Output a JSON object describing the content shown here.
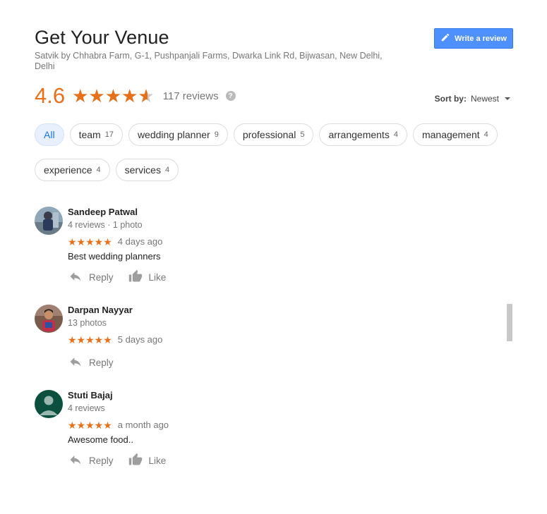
{
  "place": {
    "title": "Get Your Venue",
    "address": "Satvik by Chhabra Farm, G-1, Pushpanjali Farms, Dwarka Link Rd, Bijwasan, New Delhi, Delhi"
  },
  "write_review_label": "Write a review",
  "rating": {
    "value": "4.6",
    "stars_fraction": 0.92,
    "count_label": "117 reviews",
    "help_icon": "?"
  },
  "sort": {
    "label": "Sort by:",
    "value": "Newest"
  },
  "chips": [
    {
      "label": "All",
      "count": "",
      "active": true
    },
    {
      "label": "team",
      "count": "17"
    },
    {
      "label": "wedding planner",
      "count": "9"
    },
    {
      "label": "professional",
      "count": "5"
    },
    {
      "label": "arrangements",
      "count": "4"
    },
    {
      "label": "management",
      "count": "4"
    },
    {
      "label": "experience",
      "count": "4"
    },
    {
      "label": "services",
      "count": "4"
    }
  ],
  "reviews": [
    {
      "name": "Sandeep Patwal",
      "meta": "4 reviews · 1 photo",
      "stars": "★★★★★",
      "date": "4 days ago",
      "text": "Best wedding planners",
      "reply_label": "Reply",
      "like_label": "Like"
    },
    {
      "name": "Darpan Nayyar",
      "meta": "13 photos",
      "stars": "★★★★★",
      "date": "5 days ago",
      "text": "",
      "reply_label": "Reply"
    },
    {
      "name": "Stuti Bajaj",
      "meta": "4 reviews",
      "stars": "★★★★★",
      "date": "a month ago",
      "text": "Awesome food..",
      "reply_label": "Reply",
      "like_label": "Like"
    }
  ],
  "colors": {
    "accent_orange": "#e7711b",
    "button_blue": "#4d90fe",
    "chip_active_bg": "#e8f0fe",
    "avatar_default": "#0b4f3f"
  },
  "icons": {
    "write": "pencil-icon",
    "reply": "reply-icon",
    "like": "thumbs-up-icon",
    "sort": "caret-down-icon",
    "help": "help-icon"
  }
}
